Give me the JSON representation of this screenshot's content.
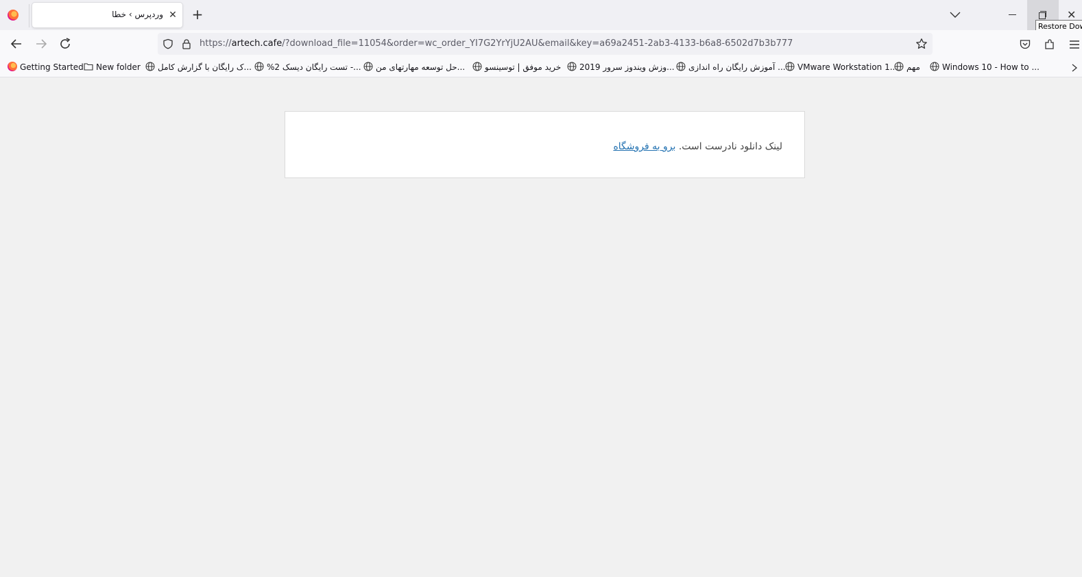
{
  "browser": {
    "tab": {
      "title": "وردپرس › خطا"
    },
    "tooltip": "Restore Down",
    "url": {
      "scheme": "https://",
      "host": "artech.cafe",
      "path": "/?download_file=11054&order=wc_order_YI7G2YrYjU2AU&email&key=a69a2451-2ab3-4133-b6a8-6502d7b3b777"
    },
    "icons": {
      "back": "back-arrow-icon",
      "forward": "forward-arrow-icon",
      "reload": "reload-icon",
      "shield": "tracking-protection-shield-icon",
      "lock": "lock-icon",
      "star": "bookmark-star-icon",
      "pocket": "pocket-icon",
      "extensions": "extensions-icon",
      "menu": "hamburger-menu-icon"
    }
  },
  "bookmarks": [
    {
      "label": "Getting Started",
      "icon": "firefox-icon"
    },
    {
      "label": "New folder",
      "icon": "folder-icon"
    },
    {
      "label": "...ک رایگان با گزارش کامل",
      "icon": "globe-icon"
    },
    {
      "label": "...- تست رایگان دیسک 2%",
      "icon": "globe-icon"
    },
    {
      "label": "...حل توسعه مهارتهای من",
      "icon": "globe-icon"
    },
    {
      "label": "خرید موفق | توسینسو",
      "icon": "globe-icon"
    },
    {
      "label": "...وزش ویندوز سرور 2019",
      "icon": "globe-icon"
    },
    {
      "label": "... آموزش رایگان راه اندازی",
      "icon": "globe-icon"
    },
    {
      "label": "VMware Workstation 1...",
      "icon": "globe-icon"
    },
    {
      "label": "مهم",
      "icon": "globe-icon"
    },
    {
      "label": "Windows 10 - How to ...",
      "icon": "globe-icon"
    }
  ],
  "page": {
    "message": "لینک دانلود نادرست است.",
    "link_label": "برو به فروشگاه",
    "link_color": "#2271b1",
    "background": "#f1f1f1"
  }
}
